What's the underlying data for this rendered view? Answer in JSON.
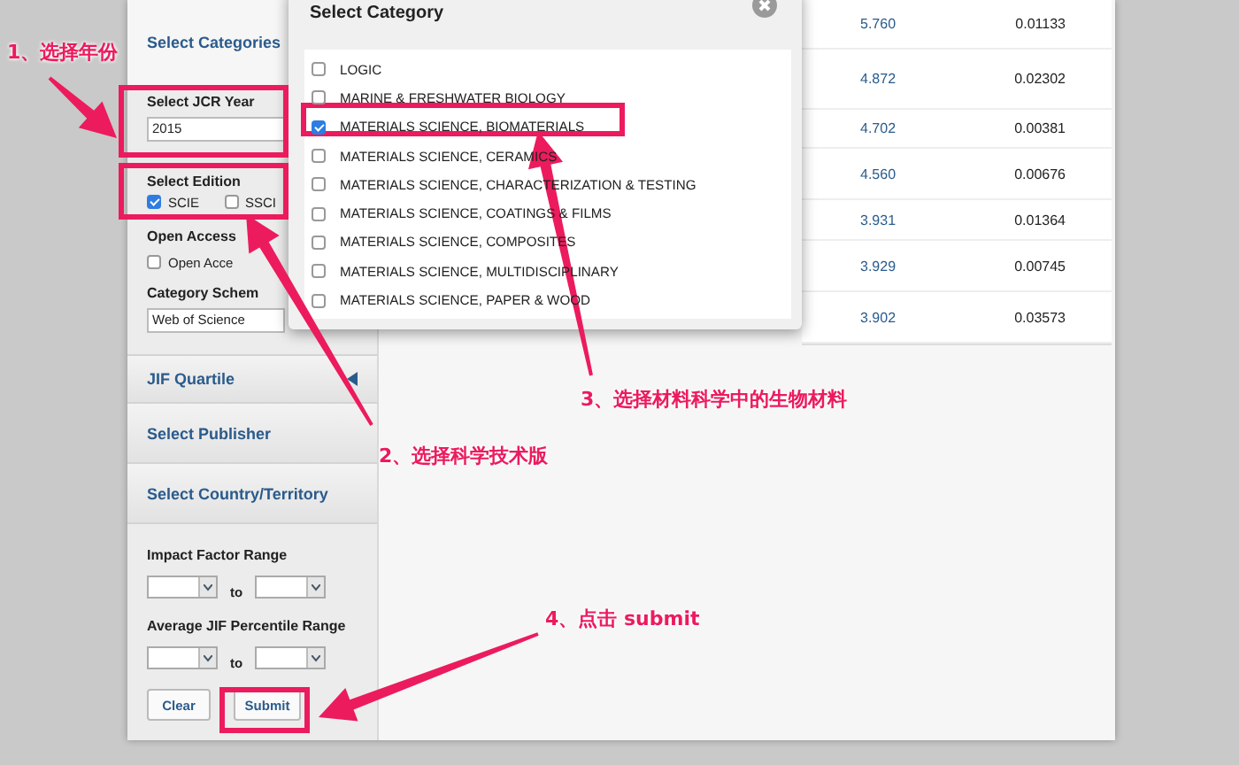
{
  "sidebar": {
    "categories_tab": "Select Categories",
    "jcr_year": {
      "label": "Select JCR Year",
      "value": "2015"
    },
    "edition": {
      "label": "Select Edition",
      "options": [
        {
          "label": "SCIE",
          "checked": true
        },
        {
          "label": "SSCI",
          "checked": false
        }
      ]
    },
    "open_access": {
      "label": "Open Access",
      "option": {
        "label": "Open Acce",
        "checked": false
      }
    },
    "category_schema": {
      "label": "Category Schem",
      "value": "Web of Science"
    },
    "sections": [
      {
        "label": "JIF Quartile",
        "expandable": true
      },
      {
        "label": "Select Publisher",
        "expandable": false
      },
      {
        "label": "Select Country/Territory",
        "expandable": false
      }
    ],
    "impact_factor_range": {
      "label": "Impact Factor Range",
      "to": "to"
    },
    "percentile_range": {
      "label": "Average JIF Percentile Range",
      "to": "to"
    },
    "buttons": [
      "Clear",
      "Submit"
    ]
  },
  "table": {
    "rows": [
      {
        "column_1": "5.760",
        "column_2": "0.01133"
      },
      {
        "column_1": "4.872",
        "column_2": "0.02302"
      },
      {
        "column_1": "4.702",
        "column_2": "0.00381"
      },
      {
        "column_1": "4.560",
        "column_2": "0.00676"
      },
      {
        "column_1": "3.931",
        "column_2": "0.01364"
      },
      {
        "column_1": "3.929",
        "column_2": "0.00745"
      },
      {
        "column_1": "3.902",
        "column_2": "0.03573"
      }
    ]
  },
  "dialog": {
    "title": "Select Category",
    "items": [
      {
        "label": "LOGIC",
        "checked": false
      },
      {
        "label": "MARINE & FRESHWATER BIOLOGY",
        "checked": false
      },
      {
        "label": "MATERIALS SCIENCE, BIOMATERIALS",
        "checked": true
      },
      {
        "label": "MATERIALS SCIENCE, CERAMICS",
        "checked": false
      },
      {
        "label": "MATERIALS SCIENCE, CHARACTERIZATION & TESTING",
        "checked": false
      },
      {
        "label": "MATERIALS SCIENCE, COATINGS & FILMS",
        "checked": false
      },
      {
        "label": "MATERIALS SCIENCE, COMPOSITES",
        "checked": false
      },
      {
        "label": "MATERIALS SCIENCE, MULTIDISCIPLINARY",
        "checked": false
      },
      {
        "label": "MATERIALS SCIENCE, PAPER & WOOD",
        "checked": false
      }
    ]
  },
  "annotations": [
    {
      "text": "1、选择年份"
    },
    {
      "text": "2、选择科学技术版"
    },
    {
      "text": "3、选择材料科学中的生物材料"
    },
    {
      "text": "4、点击 submit"
    }
  ]
}
